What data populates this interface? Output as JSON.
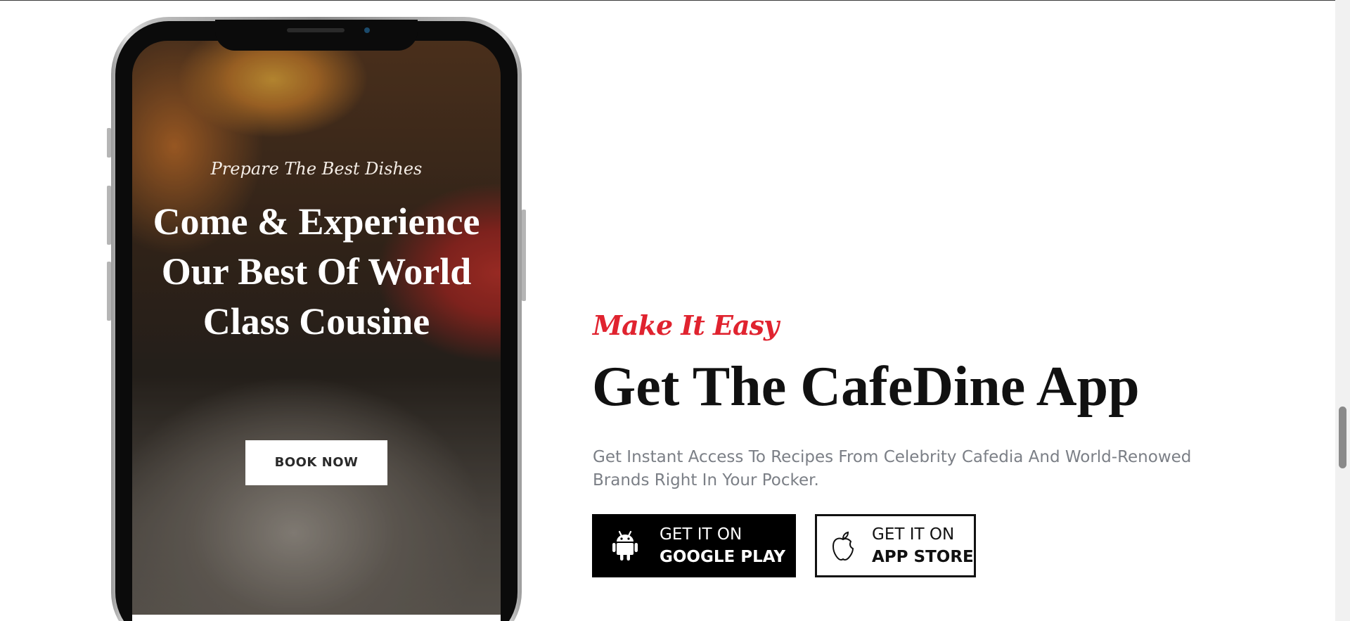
{
  "phone": {
    "screen": {
      "tagline": "Prepare The Best Dishes",
      "headline": "Come & Experience Our Best Of World Class Cousine",
      "cta_label": "BOOK NOW"
    }
  },
  "app_section": {
    "eyebrow": "Make It Easy",
    "title": "Get The CafeDine App",
    "description": "Get Instant Access To Recipes From Celebrity Cafedia And World-Renowed Brands Right In Your Pocker.",
    "google_play": {
      "line1": "GET IT ON",
      "line2": "GOOGLE PLAY",
      "icon": "android-icon"
    },
    "app_store": {
      "line1": "GET IT ON",
      "line2": "APP STORE",
      "icon": "apple-icon"
    }
  },
  "colors": {
    "accent": "#e0232f",
    "title": "#111111",
    "body_text": "#7b7f86"
  }
}
